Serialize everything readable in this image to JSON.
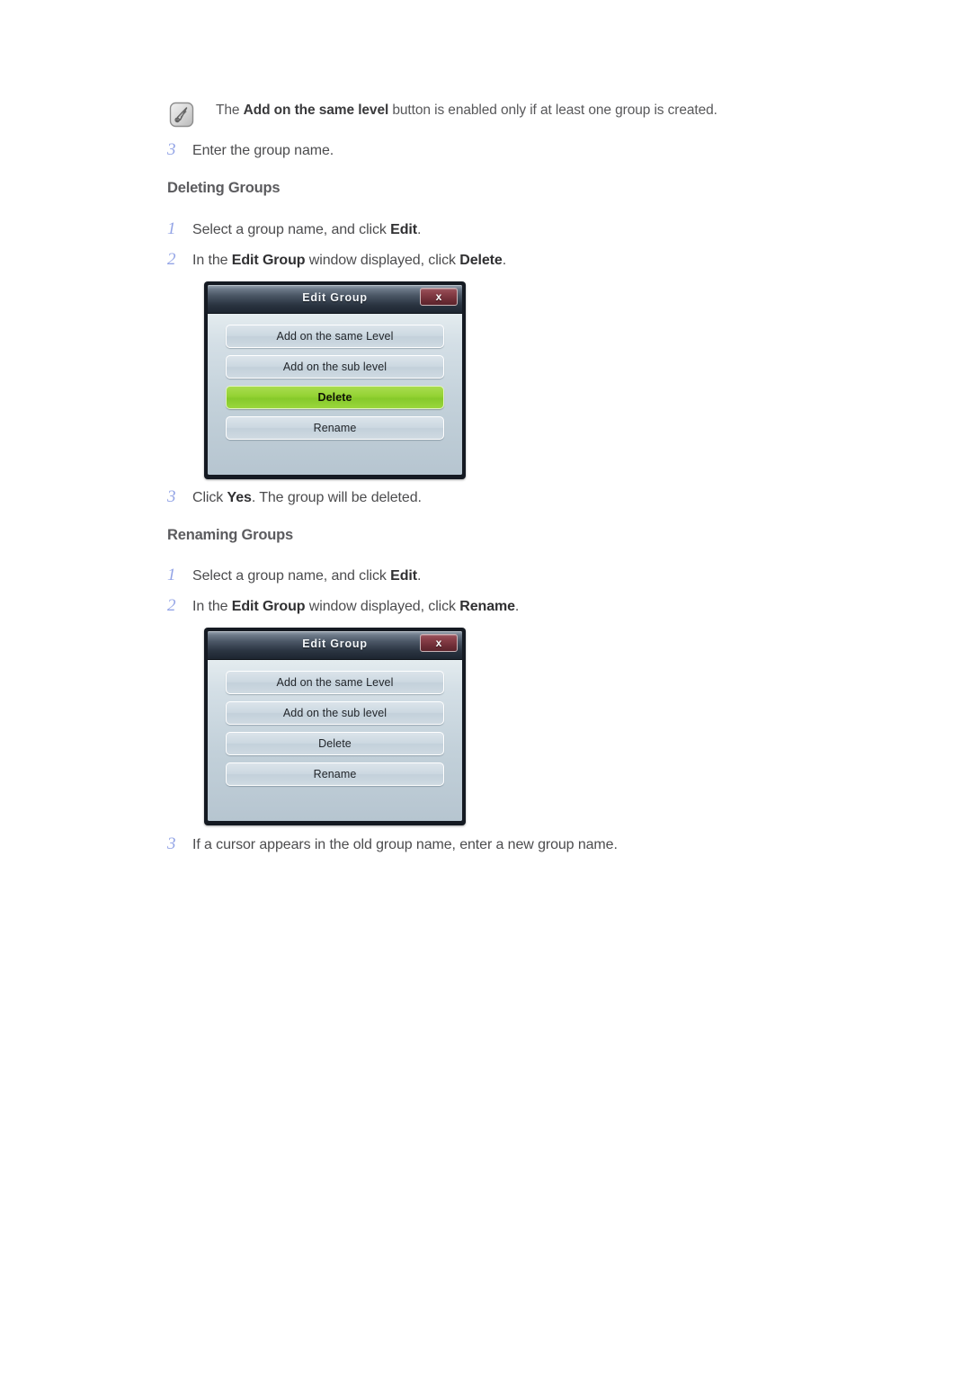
{
  "note": {
    "icon": "note-pen-icon",
    "text_before": "The ",
    "text_bold": "Add on the same level",
    "text_after": " button is enabled only if at least one group is created."
  },
  "steps": {
    "creating_step3": {
      "num": "3",
      "text": "Enter the group name."
    },
    "deleting": [
      {
        "num": "1",
        "before": "Select a group name, and click ",
        "bold": "Edit",
        "after": "."
      },
      {
        "num": "2",
        "before": "In the ",
        "bold": "Edit Group",
        "after": " window displayed, click ",
        "bold2": "Delete",
        "after2": "."
      },
      {
        "num": "3",
        "before": "Click ",
        "bold": "Yes",
        "after": ". The group will be deleted."
      }
    ],
    "renaming": [
      {
        "num": "1",
        "before": "Select a group name, and click ",
        "bold": "Edit",
        "after": "."
      },
      {
        "num": "2",
        "before": "In the ",
        "bold": "Edit Group",
        "after": " window displayed, click ",
        "bold2": "Rename",
        "after2": "."
      },
      {
        "num": "3",
        "before": "If a cursor appears in the old group name, enter a new group name.",
        "bold": "",
        "after": ""
      }
    ]
  },
  "headings": {
    "deleting_groups": "Deleting Groups",
    "renaming_groups": "Renaming Groups"
  },
  "dialog_delete": {
    "title": "Edit Group",
    "close_label": "x",
    "buttons": [
      {
        "label": "Add on the same Level",
        "highlighted": false
      },
      {
        "label": "Add on the sub level",
        "highlighted": false
      },
      {
        "label": "Delete",
        "highlighted": true
      },
      {
        "label": "Rename",
        "highlighted": false
      }
    ]
  },
  "dialog_rename": {
    "title": "Edit Group",
    "close_label": "x",
    "buttons": [
      {
        "label": "Add on the same Level",
        "highlighted": false
      },
      {
        "label": "Add on the sub level",
        "highlighted": false
      },
      {
        "label": "Delete",
        "highlighted": false
      },
      {
        "label": "Rename",
        "highlighted": false
      }
    ]
  },
  "colors": {
    "step_number": "#93a4e6",
    "body_text": "#4c4c4e",
    "heading": "#5b5b5e",
    "dialog_highlight_green": "#93d233",
    "dialog_close_red": "#8a4049",
    "dialog_titlebar_dark": "#1d2530",
    "dialog_button_face": "#ccd8e1"
  }
}
